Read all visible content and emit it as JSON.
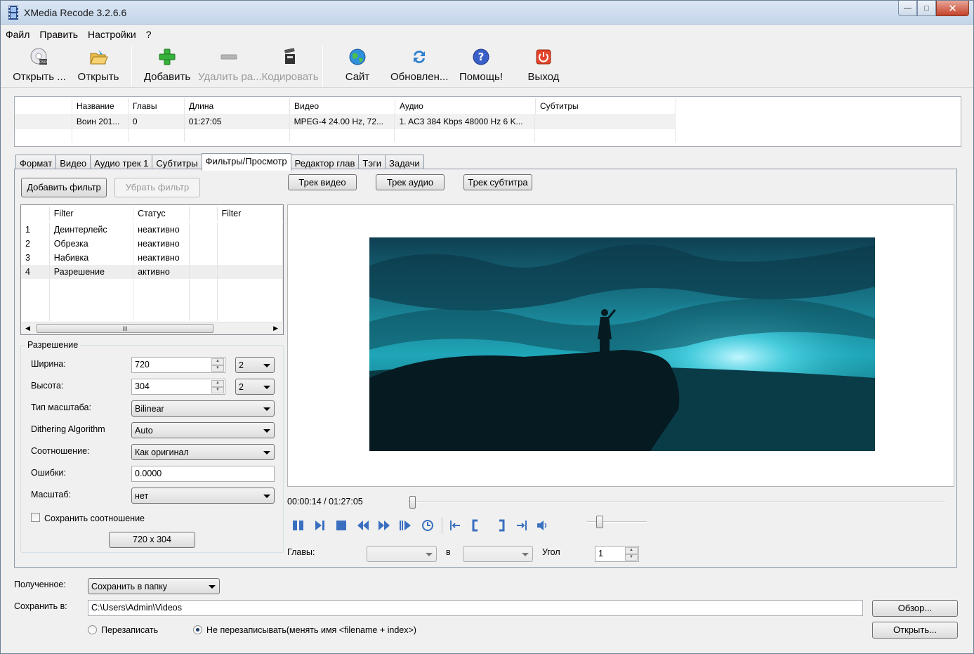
{
  "window": {
    "title": "XMedia Recode 3.2.6.6",
    "min": "—",
    "max": "□",
    "close": "✕"
  },
  "menu": [
    "Файл",
    "Править",
    "Настройки",
    "?"
  ],
  "toolbar": {
    "open_disc": "Открыть ...",
    "open": "Открыть",
    "add": "Добавить",
    "remove": "Удалить ра...",
    "encode": "Кодировать",
    "site": "Сайт",
    "update": "Обновлен...",
    "help": "Помощь!",
    "exit": "Выход"
  },
  "filelist": {
    "columns": [
      "Название",
      "Главы",
      "Длина",
      "Видео",
      "Аудио",
      "Субтитры"
    ],
    "rows": [
      [
        "Воин 201...",
        "0",
        "01:27:05",
        "MPEG-4 24.00 Hz, 72...",
        "1. AC3 384 Kbps 48000 Hz 6 K...",
        ""
      ]
    ]
  },
  "tabs": [
    "Формат",
    "Видео",
    "Аудио трек 1",
    "Субтитры",
    "Фильтры/Просмотр",
    "Редактор глав",
    "Тэги",
    "Задачи"
  ],
  "filters": {
    "add_button": "Добавить фильтр",
    "remove_button": "Убрать фильтр",
    "columns": [
      "",
      "Filter",
      "Статус",
      "",
      "Filter"
    ],
    "rows": [
      [
        "1",
        "Деинтерлейс",
        "неактивно"
      ],
      [
        "2",
        "Обрезка",
        "неактивно"
      ],
      [
        "3",
        "Набивка",
        "неактивно"
      ],
      [
        "4",
        "Разрешение",
        "активно"
      ]
    ],
    "scroll_grip": "III"
  },
  "resolution": {
    "title": "Разрешение",
    "width_label": "Ширина:",
    "width_value": "720",
    "width_mult": "2",
    "height_label": "Высота:",
    "height_value": "304",
    "height_mult": "2",
    "scale_type_label": "Тип масштаба:",
    "scale_type_value": "Bilinear",
    "dithering_label": "Dithering Algorithm",
    "dithering_value": "Auto",
    "ratio_label": "Соотношение:",
    "ratio_value": "Как оригинал",
    "errors_label": "Ошибки:",
    "errors_value": "0.0000",
    "scale_label": "Масштаб:",
    "scale_value": "нет",
    "keep_ratio_label": "Сохранить соотношение",
    "keep_ratio_checked": false,
    "size_button": "720 x 304"
  },
  "preview": {
    "track_video": "Трек видео",
    "track_audio": "Трек аудио",
    "track_subtitle": "Трек субтитра",
    "time": "00:00:14 / 01:27:05",
    "position_fraction": 0.003,
    "chapters_label": "Главы:",
    "to_label": "в",
    "angle_label": "Угол",
    "angle_value": "1"
  },
  "output": {
    "received_label": "Полученное:",
    "received_value": "Сохранить в папку",
    "save_to_label": "Сохранить в:",
    "save_path": "C:\\Users\\Admin\\Videos",
    "browse_button": "Обзор...",
    "open_button": "Открыть...",
    "overwrite_label": "Перезаписать",
    "no_overwrite_label": "Не перезаписывать(менять имя <filename + index>)",
    "no_overwrite_checked": true
  },
  "colors": {
    "accent": "#1f5fa8",
    "video_tint": "#1fa6b8"
  }
}
